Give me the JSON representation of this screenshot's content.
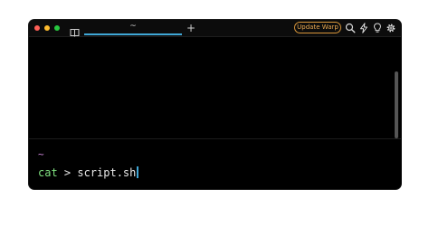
{
  "tabs": [
    {
      "title": "~"
    }
  ],
  "new_tab_label": "+",
  "update_button": {
    "label": "Update Warp"
  },
  "toolbar_icons": [
    "search-icon",
    "lightning-icon",
    "lightbulb-icon",
    "gear-icon"
  ],
  "terminal": {
    "prompt_dir": "~",
    "command": "cat",
    "args": " > script.sh"
  },
  "colors": {
    "window_bg": "#000000",
    "accent": "#3fa7d6",
    "update_orange": "#e9a850",
    "prompt_dir": "#d48ae0",
    "command": "#7fe07f"
  }
}
